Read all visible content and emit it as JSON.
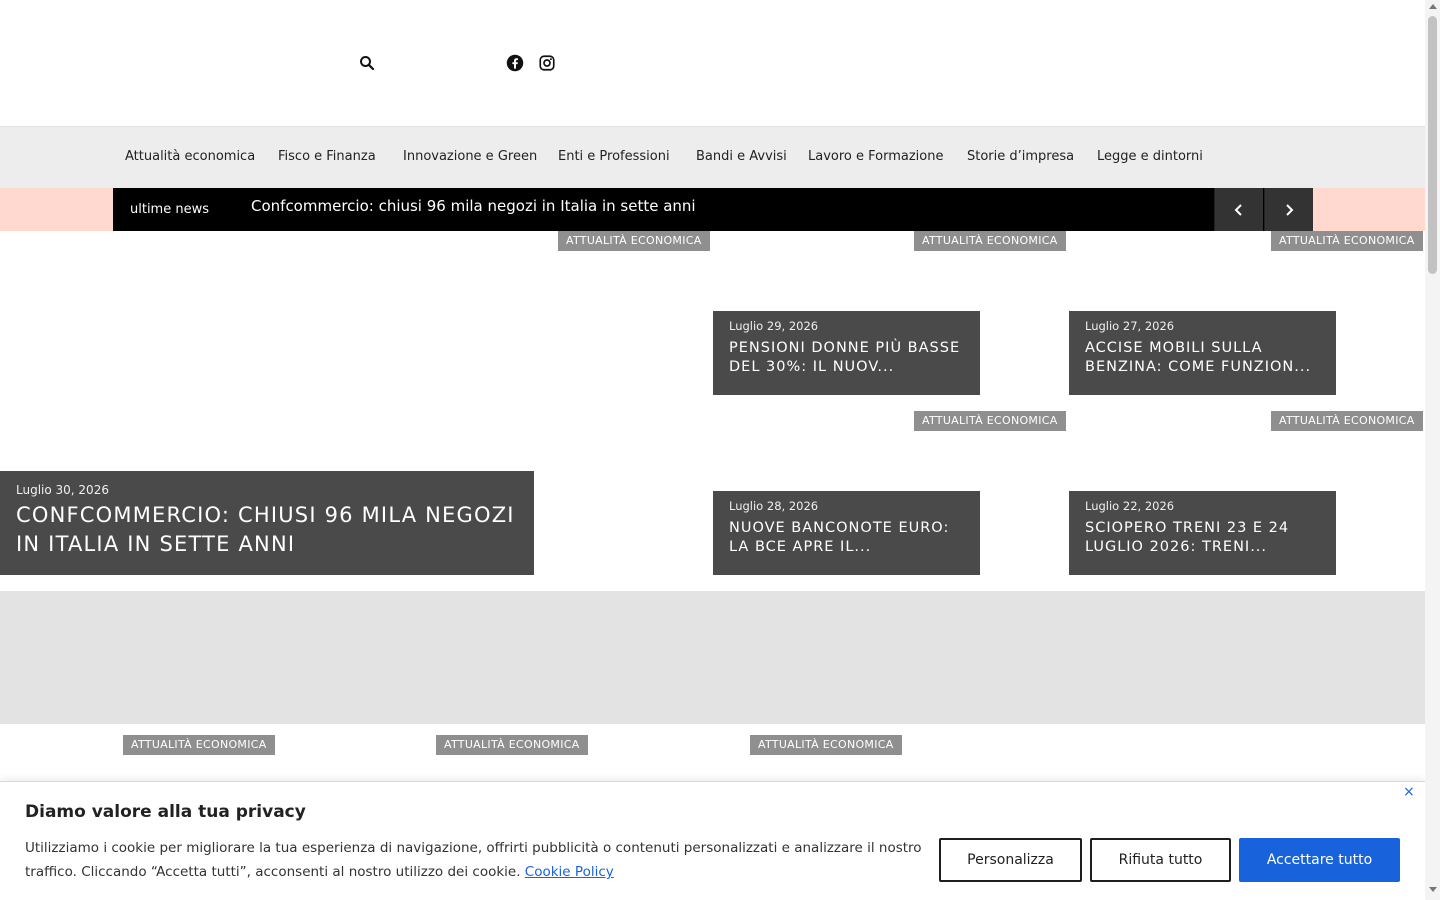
{
  "header": {
    "search_icon": "search-icon",
    "social_icons": [
      "facebook-icon",
      "instagram-icon"
    ]
  },
  "nav": {
    "items": [
      "Attualità economica",
      "Fisco e Finanza",
      "Innovazione e Green",
      "Enti e Professioni",
      "Bandi e Avvisi",
      "Lavoro e Formazione",
      "Storie d’impresa",
      "Legge e dintorni"
    ]
  },
  "ticker": {
    "label": "ultime news",
    "headline": "Confcommercio: chiusi 96 mila negozi in Italia in sette anni"
  },
  "featured": {
    "main": {
      "tag": "ATTUALITÀ ECONOMICA",
      "date": "Luglio 30, 2026",
      "title": "CONFCOMMERCIO: CHIUSI 96 MILA NEGOZI IN ITALIA IN SETTE ANNI"
    },
    "cards": [
      {
        "tag": "ATTUALITÀ ECONOMICA",
        "date": "Luglio 29, 2026",
        "title": "PENSIONI DONNE PIÙ BASSE DEL 30%: IL NUOV..."
      },
      {
        "tag": "ATTUALITÀ ECONOMICA",
        "date": "Luglio 27, 2026",
        "title": "ACCISE MOBILI SULLA BENZINA: COME FUNZION..."
      },
      {
        "tag": "ATTUALITÀ ECONOMICA",
        "date": "Luglio 28, 2026",
        "title": "NUOVE BANCONOTE EURO: LA BCE APRE IL..."
      },
      {
        "tag": "ATTUALITÀ ECONOMICA",
        "date": "Luglio 22, 2026",
        "title": "SCIOPERO TRENI 23 E 24 LUGLIO 2026: TRENI..."
      }
    ]
  },
  "lower_tags": [
    "ATTUALITÀ ECONOMICA",
    "ATTUALITÀ ECONOMICA",
    "ATTUALITÀ ECONOMICA"
  ],
  "cookie": {
    "title": "Diamo valore alla tua privacy",
    "text": "Utilizziamo i cookie per migliorare la tua esperienza di navigazione, offrirti pubblicità o contenuti personalizzati e analizzare il nostro traffico. Cliccando “Accetta tutti”, acconsenti al nostro utilizzo dei cookie. ",
    "policy_link": "Cookie Policy",
    "close": "×",
    "customize": "Personalizza",
    "reject": "Rifiuta tutto",
    "accept": "Accettare tutto"
  },
  "colors": {
    "ticker_band": "#ffd9cf",
    "accent_blue": "#1863dc",
    "card_bg": "#4a4a4a",
    "tag_bg": "#8f8f8f"
  }
}
